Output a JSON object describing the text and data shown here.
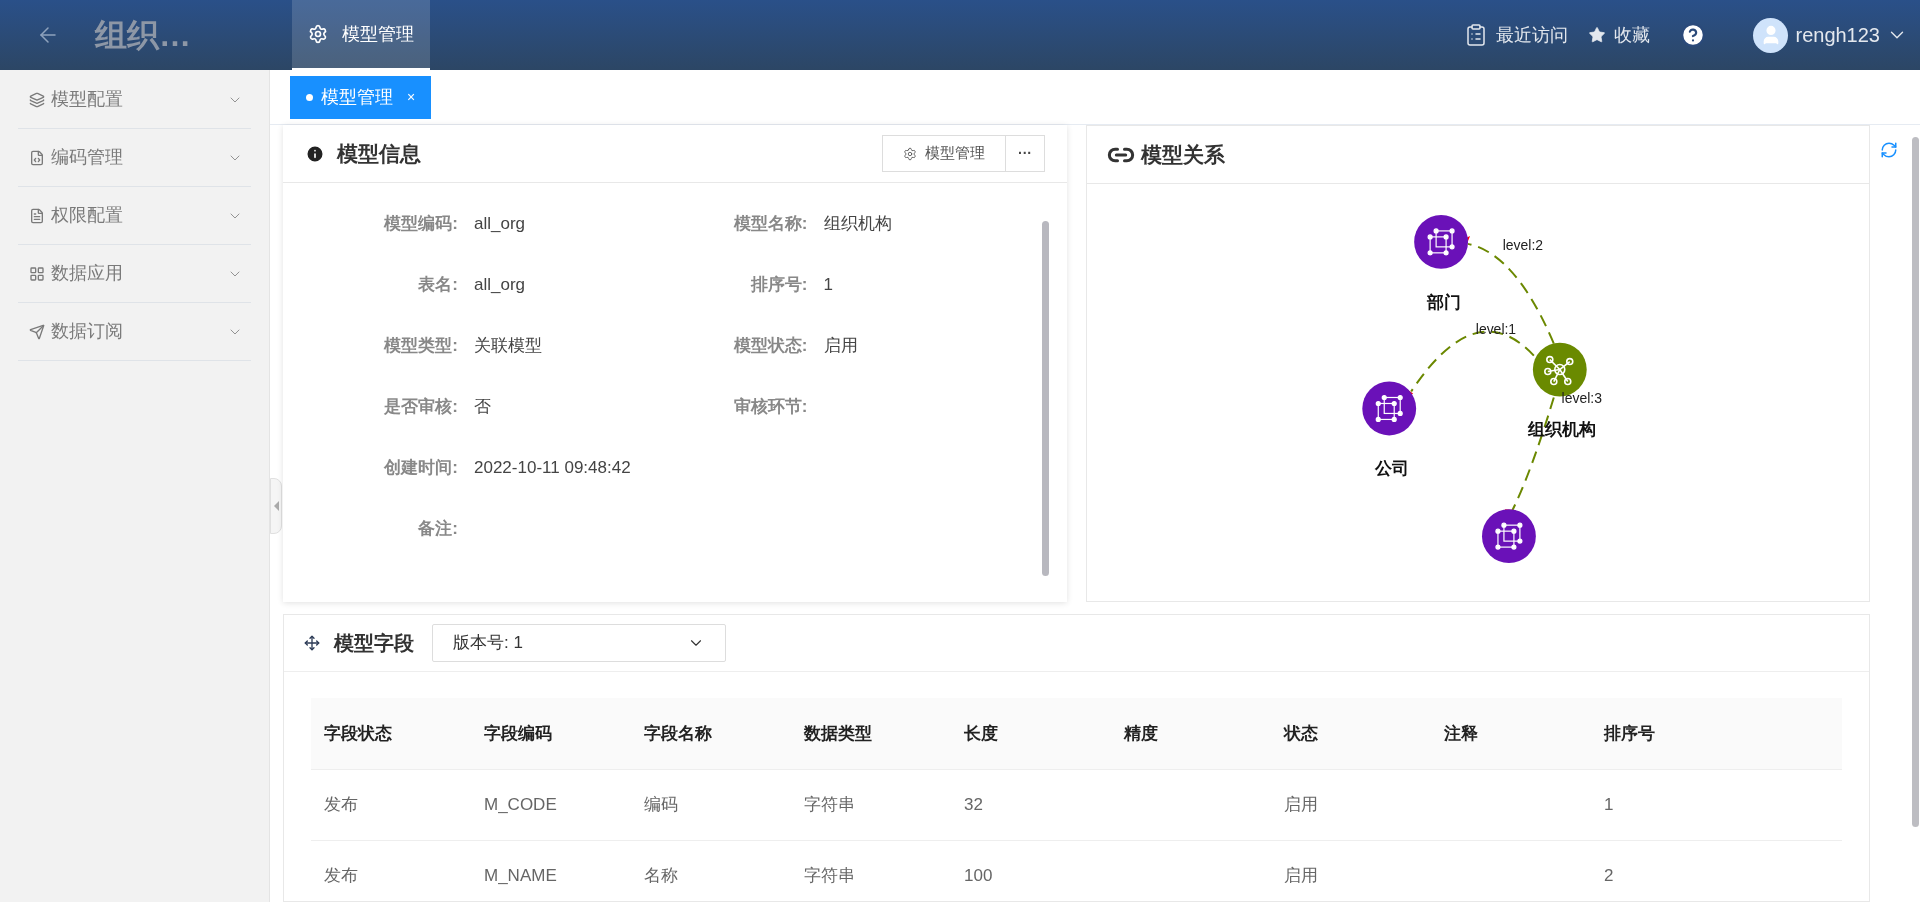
{
  "header": {
    "title": "组织…",
    "nav_tabs": [
      {
        "label": "模型管理",
        "selected": true
      }
    ],
    "recent": "最近访问",
    "favorites": "收藏",
    "user": "rengh123"
  },
  "sidebar": {
    "items": [
      {
        "label": "模型配置"
      },
      {
        "label": "编码管理"
      },
      {
        "label": "权限配置"
      },
      {
        "label": "数据应用"
      },
      {
        "label": "数据订阅"
      }
    ]
  },
  "page_tabs": [
    {
      "label": "模型管理",
      "selected": true,
      "close": "×"
    }
  ],
  "model_info": {
    "title": "模型信息",
    "manage_button": "模型管理",
    "more_button": "···",
    "fields": [
      {
        "label": "模型编码:",
        "value": "all_org"
      },
      {
        "label": "模型名称:",
        "value": "组织机构"
      },
      {
        "label": "表名:",
        "value": "all_org"
      },
      {
        "label": "排序号:",
        "value": "1"
      },
      {
        "label": "模型类型:",
        "value": "关联模型"
      },
      {
        "label": "模型状态:",
        "value": "启用"
      },
      {
        "label": "是否审核:",
        "value": "否"
      },
      {
        "label": "审核环节:"
      },
      {
        "label": "创建时间:",
        "value": "2022-10-11 09:48:42",
        "kind": "wide"
      },
      {
        "label": "备注:",
        "kind": "wide"
      }
    ]
  },
  "model_relation": {
    "title": "模型关系",
    "nodes": [
      {
        "label": "部门",
        "kind": "entity"
      },
      {
        "label": "组织机构",
        "kind": "center"
      },
      {
        "label": "公司",
        "kind": "entity"
      },
      {
        "kind": "entity"
      }
    ],
    "edges": [
      {
        "label": "level:2"
      },
      {
        "label": "level:1"
      },
      {
        "label": "level:3"
      }
    ]
  },
  "model_fields": {
    "title": "模型字段",
    "version": "版本号: 1",
    "columns": [
      "字段状态",
      "字段编码",
      "字段名称",
      "数据类型",
      "长度",
      "精度",
      "状态",
      "注释",
      "排序号"
    ],
    "rows": [
      [
        "发布",
        "M_CODE",
        "编码",
        "字符串",
        "32",
        "",
        "启用",
        "",
        "1"
      ],
      [
        "发布",
        "M_NAME",
        "名称",
        "字符串",
        "100",
        "",
        "启用",
        "",
        "2"
      ]
    ]
  }
}
